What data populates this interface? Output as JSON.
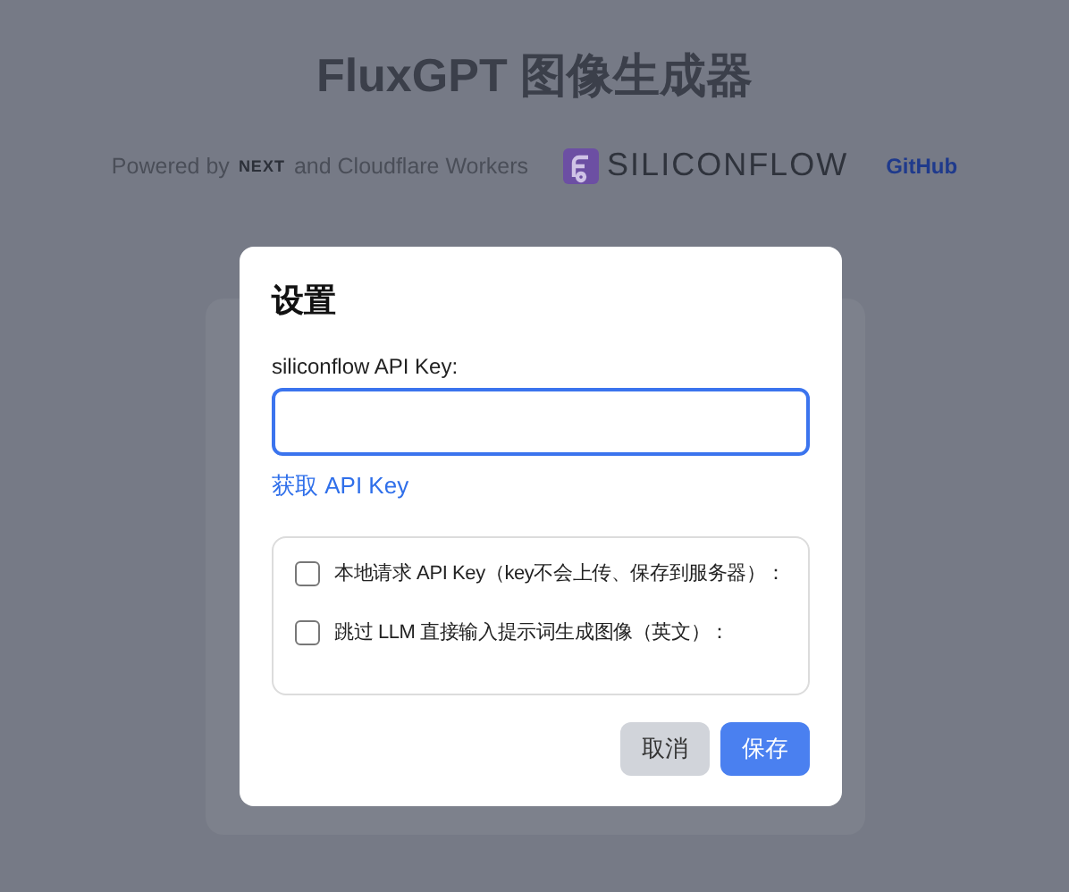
{
  "header": {
    "title": "FluxGPT 图像生成器",
    "powered_by": "Powered by",
    "next_logo": "NEXT",
    "and_text": "and Cloudflare Workers",
    "sponsor_logo": "SILICONFLOW",
    "github_link": "GitHub"
  },
  "dialog": {
    "title": "设置",
    "api_key_label": "siliconflow API Key:",
    "api_key": {
      "focused": true
    },
    "get_key_link": "获取 API Key",
    "options": [
      {
        "label": "本地请求 API Key（key不会上传、保存到服务器）：",
        "checked": false
      },
      {
        "label": "跳过 LLM 直接输入提示词生成图像（英文）：",
        "checked": false
      }
    ],
    "buttons": [
      {
        "label": "取消",
        "kind": "secondary"
      },
      {
        "label": "保存",
        "kind": "primary"
      }
    ]
  }
}
